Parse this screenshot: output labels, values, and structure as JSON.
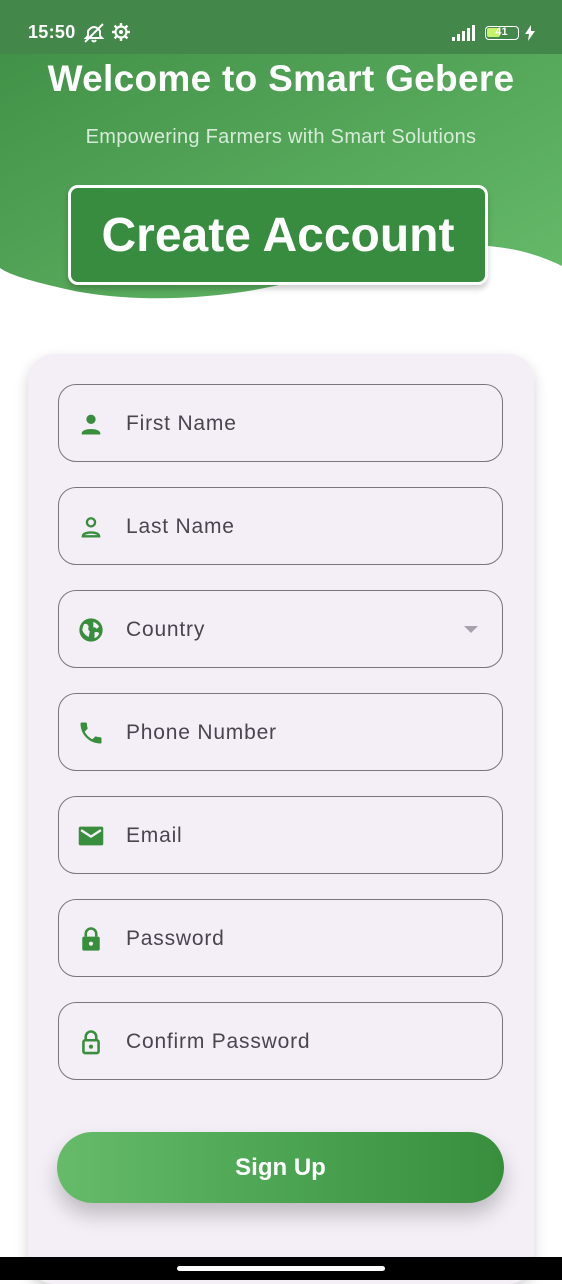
{
  "status_bar": {
    "time": "15:50",
    "battery": "41",
    "icons": [
      "vibrate-off-icon",
      "settings-icon",
      "signal-icon",
      "battery-icon",
      "charging-icon"
    ]
  },
  "header": {
    "title": "Welcome to Smart Gebere",
    "subtitle": "Empowering Farmers with Smart Solutions",
    "create_account": "Create Account"
  },
  "form": {
    "fields": [
      {
        "label": "First Name",
        "icon": "person-icon"
      },
      {
        "label": "Last Name",
        "icon": "person-outline-icon"
      },
      {
        "label": "Country",
        "icon": "globe-icon",
        "type": "dropdown"
      },
      {
        "label": "Phone Number",
        "icon": "phone-icon"
      },
      {
        "label": "Email",
        "icon": "email-icon"
      },
      {
        "label": "Password",
        "icon": "lock-icon"
      },
      {
        "label": "Confirm Password",
        "icon": "lock-outline-icon"
      }
    ],
    "submit": "Sign Up"
  },
  "colors": {
    "primary": "#388e3c",
    "primary_light": "#66bb6a",
    "card_bg": "#f4eff7",
    "border": "#79747e"
  }
}
